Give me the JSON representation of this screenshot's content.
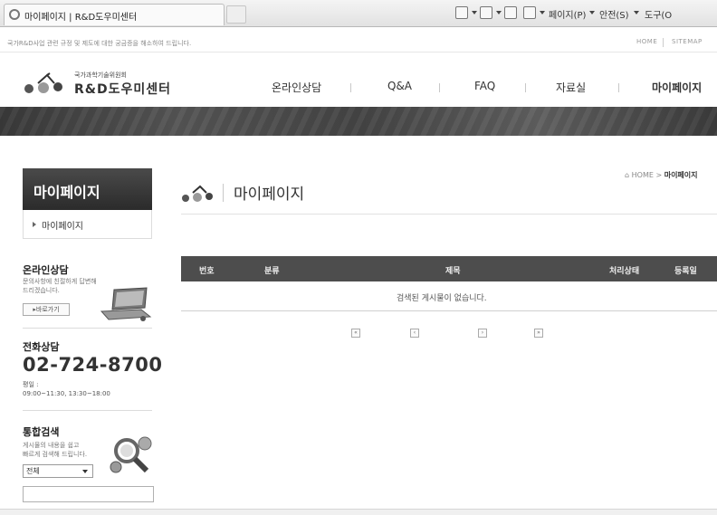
{
  "browser": {
    "tab_title": "마이페이지 | R&D도우미센터",
    "toolbar": {
      "page_menu": "페이지(P)",
      "safety_menu": "안전(S)",
      "tools_menu": "도구(O"
    }
  },
  "top_strip": {
    "notice": "국가R&D사업 관련 규정 및 제도에 대한 궁금증을 해소하여 드립니다.",
    "links": [
      "HOME",
      "SITEMAP"
    ]
  },
  "header": {
    "logo_subtitle": "국가과학기술위원회",
    "logo_title": "R&D도우미센터",
    "nav": [
      "온라인상담",
      "Q&A",
      "FAQ",
      "자료실",
      "마이페이지"
    ]
  },
  "sidebar": {
    "title": "마이페이지",
    "menu": [
      "마이페이지"
    ],
    "online": {
      "title": "온라인상담",
      "desc_lines": [
        "문의사항에 친절하게 답변해",
        "드리겠습니다."
      ],
      "button": "바로가기"
    },
    "phone": {
      "title": "전화상담",
      "number": "02-724-8700",
      "hours_label": "평일 :",
      "hours": "09:00~11:30, 13:30~18:00"
    },
    "search": {
      "title": "통합검색",
      "desc_lines": [
        "게시물의 내용을 쉽고",
        "빠르게 검색해 드립니다."
      ],
      "select_value": "전체",
      "input_value": ""
    }
  },
  "content": {
    "breadcrumb_home": "HOME",
    "breadcrumb_sep": ">",
    "breadcrumb_current": "마이페이지",
    "page_title": "마이페이지",
    "table": {
      "headers": [
        "번호",
        "분류",
        "제목",
        "처리상태",
        "등록일"
      ],
      "empty_message": "검색된 게시물이 없습니다."
    }
  },
  "colors": {
    "table_header_bg": "#4d4d4d",
    "sidebar_title_bg": "#2b2b2b",
    "banner_bg": "#454545"
  }
}
